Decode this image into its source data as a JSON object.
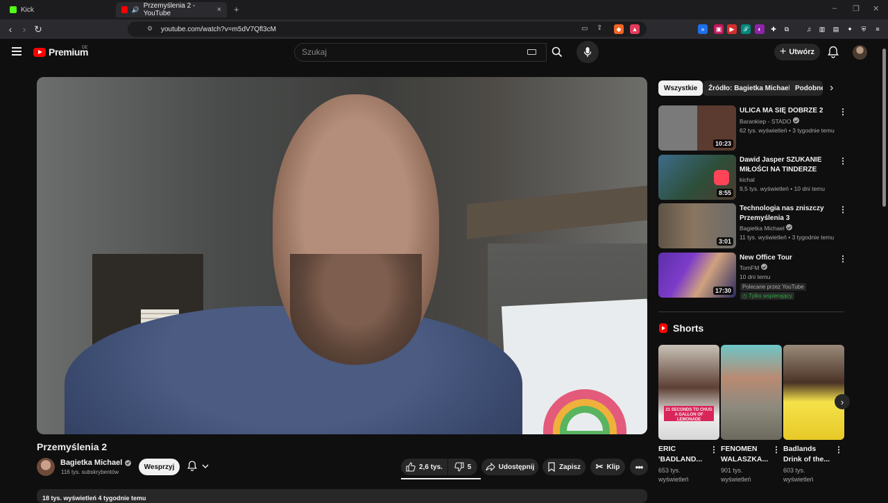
{
  "browser": {
    "tabs": [
      {
        "label": "Kick",
        "active": false
      },
      {
        "label": "Przemyślenia 2 - YouTube",
        "active": true
      }
    ],
    "url": "youtube.com/watch?v=m5dV7Qfl3cM"
  },
  "header": {
    "logo_text": "Premium",
    "logo_sup": "DE",
    "search_placeholder": "Szukaj",
    "create_label": "Utwórz"
  },
  "video": {
    "title": "Przemyślenia 2",
    "channel": {
      "name": "Bagietka Michael",
      "subscribers": "116 tys. subskrybentów"
    },
    "support_label": "Wesprzyj",
    "likes": "2,6 tys.",
    "dislikes": "5",
    "share_label": "Udostępnij",
    "save_label": "Zapisz",
    "clip_label": "Klip",
    "views_line": "18 tys. wyświetleń  4 tygodnie temu"
  },
  "chips": [
    "Wszystkie",
    "Źródło: Bagietka Michael",
    "Podobne"
  ],
  "recommendations": [
    {
      "title": "ULICA MA SIĘ DOBRZE 2",
      "channel": "Barankiep - STADO",
      "verified": true,
      "stats": "62 tys. wyświetleń • 3 tygodnie temu",
      "duration": "10:23"
    },
    {
      "title": "Dawid Jasper SZUKANIE MIŁOŚCI NA TINDERZE",
      "channel": "kichal",
      "verified": false,
      "stats": "9,5 tys. wyświetleń • 10 dni temu",
      "duration": "8:55"
    },
    {
      "title": "Technologia nas zniszczy Przemyślenia 3",
      "channel": "Bagietka Michael",
      "verified": true,
      "stats": "11 tys. wyświetleń • 3 tygodnie temu",
      "duration": "3:01"
    },
    {
      "title": "New Office Tour",
      "channel": "TomFM",
      "verified": true,
      "stats": "10 dni temu",
      "duration": "17:30",
      "badge": "Polecane przez YouTube",
      "badge2": "Tylko wspierający"
    }
  ],
  "shorts": {
    "heading": "Shorts",
    "items": [
      {
        "title": "ERIC 'BADLAND...",
        "views": "653 tys. wyświetleń",
        "overlay": "21 SECONDS TO CHUG A GALLON OF LEMONADE"
      },
      {
        "title": "FENOMEN WALASZKA...",
        "views": "901 tys. wyświetleń"
      },
      {
        "title": "Badlands Drink of the...",
        "views": "603 tys. wyświetleń"
      }
    ]
  },
  "colors": {
    "accent": "#ff0000",
    "background": "#0f0f0f",
    "chip_bg": "#272727",
    "member_green": "#2ba640"
  }
}
